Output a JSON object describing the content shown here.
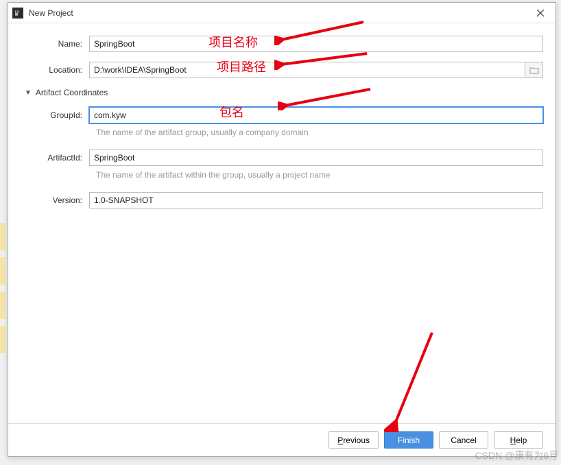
{
  "window": {
    "title": "New Project"
  },
  "form": {
    "name_label": "Name:",
    "name_value": "SpringBoot",
    "location_label": "Location:",
    "location_value": "D:\\work\\IDEA\\SpringBoot",
    "section_title": "Artifact Coordinates",
    "groupid_label": "GroupId:",
    "groupid_value": "com.kyw",
    "groupid_help": "The name of the artifact group, usually a company domain",
    "artifactid_label": "ArtifactId:",
    "artifactid_value": "SpringBoot",
    "artifactid_help": "The name of the artifact within the group, usually a project name",
    "version_label": "Version:",
    "version_value": "1.0-SNAPSHOT"
  },
  "footer": {
    "previous": "Previous",
    "finish": "Finish",
    "cancel": "Cancel",
    "help": "Help"
  },
  "annotations": {
    "name": "项目名称",
    "location": "项目路径",
    "groupid": "包名"
  },
  "watermark": "CSDN @康有为6号"
}
